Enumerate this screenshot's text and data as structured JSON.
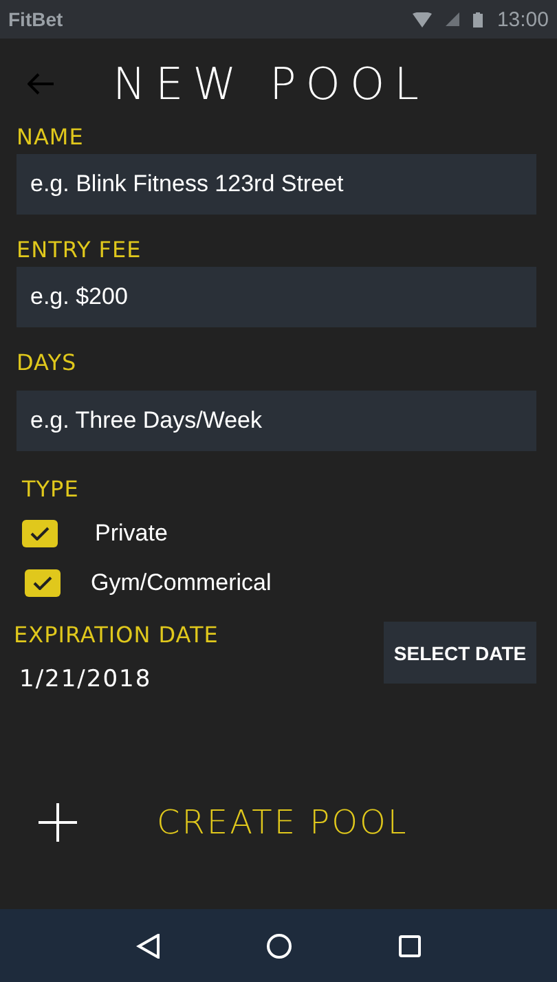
{
  "status_bar": {
    "app_name": "FitBet",
    "time": "13:00"
  },
  "header": {
    "title": "NEW POOL"
  },
  "fields": [
    {
      "label": "NAME",
      "placeholder": "e.g. Blink Fitness 123rd Street"
    },
    {
      "label": "ENTRY FEE",
      "placeholder": "e.g. $200"
    },
    {
      "label": "DAYS",
      "placeholder": "e.g. Three Days/Week"
    }
  ],
  "type": {
    "label": "TYPE",
    "options": [
      {
        "label": "Private",
        "checked": true
      },
      {
        "label": "Gym/Commerical",
        "checked": true
      }
    ]
  },
  "expiration": {
    "label": "EXPIRATION DATE",
    "value": "1/21/2018",
    "button": "SELECT DATE"
  },
  "create_button": {
    "label": "CREATE POOL"
  }
}
